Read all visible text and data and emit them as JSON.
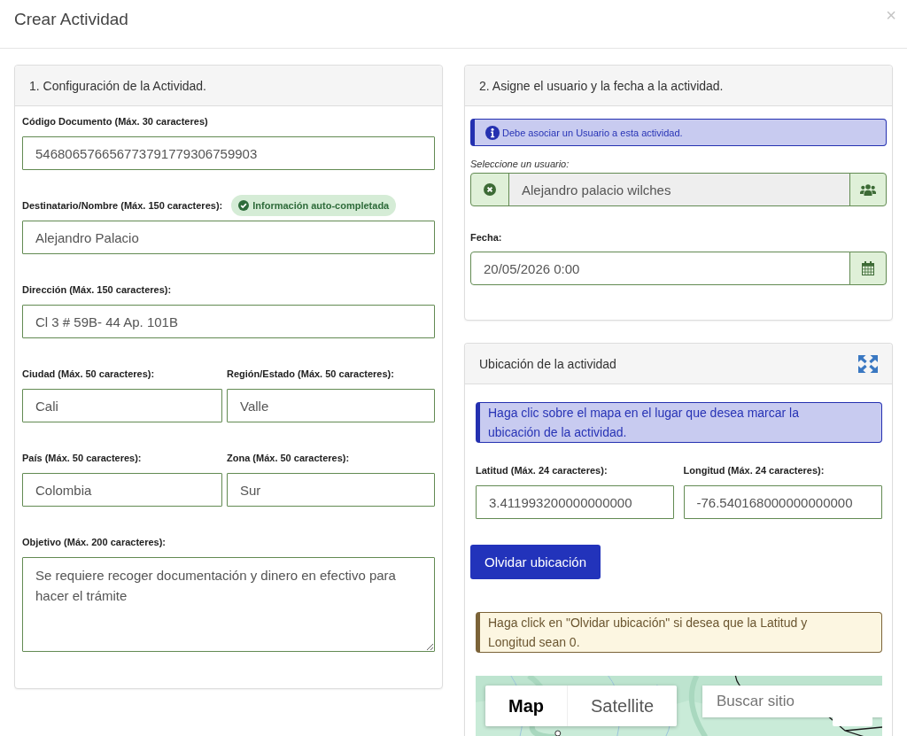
{
  "dialog": {
    "title": "Crear Actividad",
    "close": "×"
  },
  "config_panel": {
    "title": "1. Configuración de la Actividad.",
    "rows": [
      [
        {
          "label": "Código Documento (Máx. 30 caracteres)",
          "kind": "input",
          "value": "546806576656773791779306759903"
        }
      ],
      [
        {
          "label": "Destinatario/Nombre (Máx. 150 caracteres):",
          "kind": "input",
          "value": "Alejandro Palacio",
          "badge": "Información auto-completada"
        }
      ],
      [
        {
          "label": "Dirección (Máx. 150 caracteres):",
          "kind": "input",
          "value": "Cl 3 # 59B- 44 Ap. 101B"
        }
      ],
      [
        {
          "label": "Ciudad (Máx. 50 caracteres):",
          "kind": "input",
          "value": "Cali"
        },
        {
          "label": "Región/Estado (Máx. 50 caracteres):",
          "kind": "input",
          "value": "Valle"
        }
      ],
      [
        {
          "label": "País (Máx. 50 caracteres):",
          "kind": "input",
          "value": "Colombia"
        },
        {
          "label": "Zona (Máx. 50 caracteres):",
          "kind": "input",
          "value": "Sur"
        }
      ],
      [
        {
          "label": "Objetivo (Máx. 200 caracteres):",
          "kind": "textarea",
          "value": "Se requiere recoger documentación y dinero en efectivo para hacer el trámite"
        }
      ]
    ]
  },
  "assign_panel": {
    "title": "2. Asigne el usuario y la fecha a la actividad.",
    "alert": {
      "kind": "info",
      "icon": true,
      "text": "Debe asociar un Usuario a esta actividad."
    },
    "user_field": {
      "label": "Seleccione un usuario:",
      "value": "Alejandro palacio wilches",
      "disabled": true
    },
    "date_field": {
      "label": "Fecha:",
      "value": "20/05/2026 0:00",
      "disabled": false
    }
  },
  "location_panel": {
    "title": "Ubicación de la actividad",
    "hint": {
      "kind": "info",
      "text": "Haga clic sobre el mapa en el lugar que desea marcar la ubicación de la actividad."
    },
    "coordinates": [
      {
        "label": "Latitud (Máx. 24 caracteres):",
        "value": "3.411993200000000000"
      },
      {
        "label": "Longitud (Máx. 24 caracteres):",
        "value": "-76.540168000000000000"
      }
    ],
    "forget_button": "Olvidar ubicación",
    "warning": {
      "kind": "warning",
      "text": "Haga click en \"Olvidar ubicación\" si desea que la Latitud y Longitud sean 0."
    },
    "map": {
      "map_types": [
        {
          "label": "Map",
          "selected": true
        },
        {
          "label": "Satellite",
          "selected": false
        }
      ],
      "search": {
        "placeholder": "Buscar sitio"
      }
    }
  }
}
